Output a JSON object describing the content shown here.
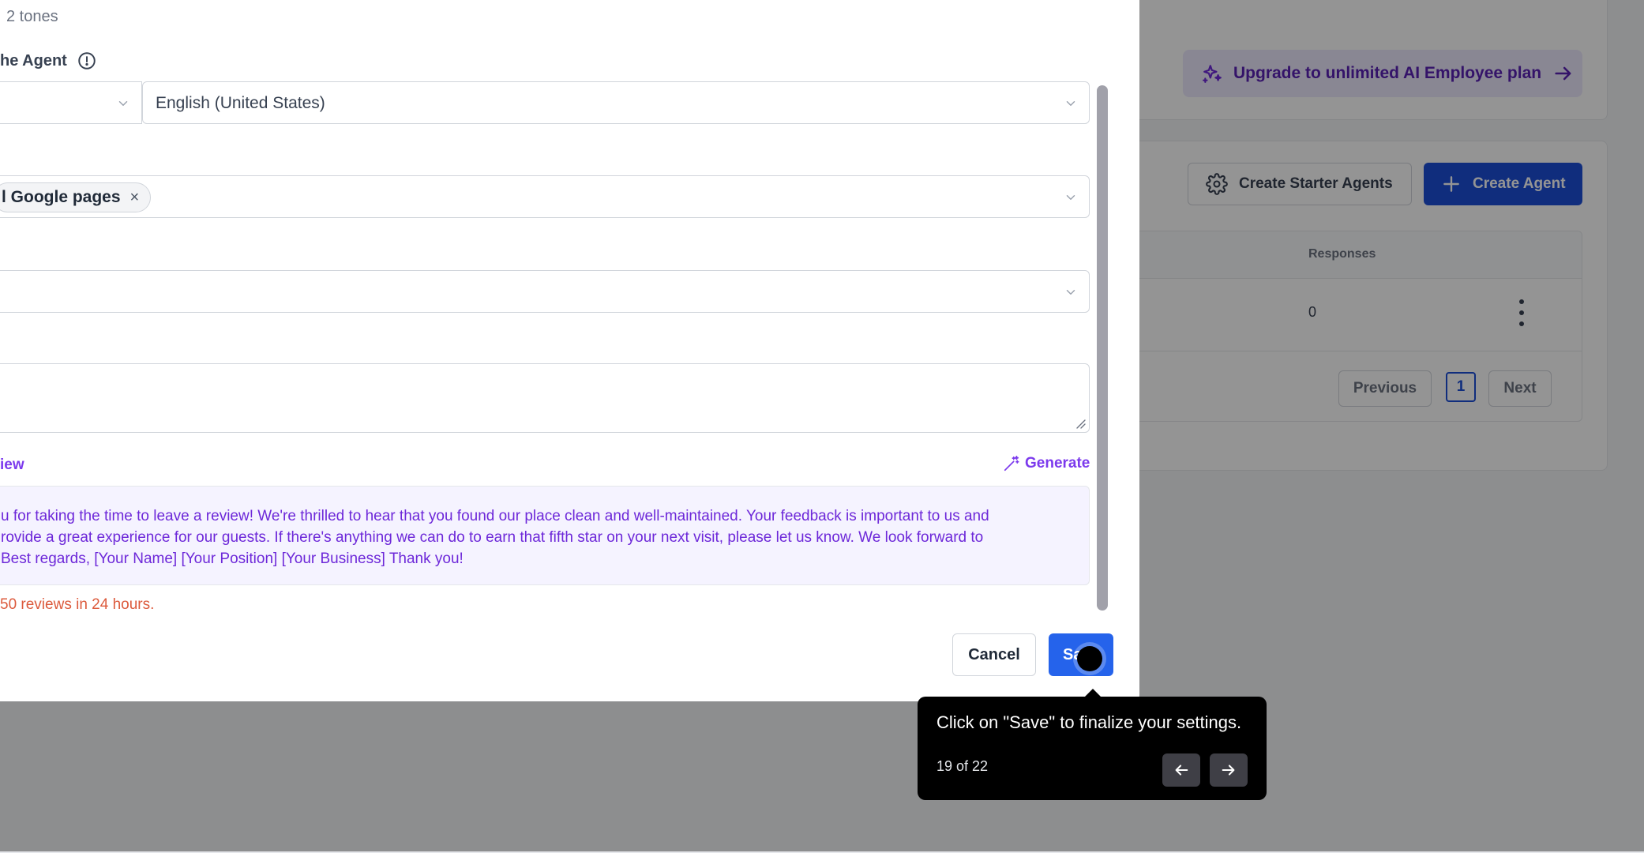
{
  "background": {
    "upgrade_label": "Upgrade to unlimited AI Employee plan",
    "create_starter_label": "Create Starter Agents",
    "create_agent_label": "Create Agent",
    "table": {
      "header_responses": "Responses",
      "rows": [
        {
          "responses": "0"
        }
      ]
    },
    "pagination": {
      "previous": "Previous",
      "current_page": "1",
      "next": "Next"
    }
  },
  "modal": {
    "tones_text": "2 tones",
    "agent_label": "he Agent",
    "language_value": "English (United States)",
    "pages_chip": "l Google pages",
    "chip_remove": "×",
    "preview_label": "iew",
    "generate_label": "Generate",
    "preview_lines": [
      "u for taking the time to leave a review! We're thrilled to hear that you found our place clean and well-maintained. Your feedback is important to us and",
      "rovide a great experience for our guests. If there's anything we can do to earn that fifth star on your next visit, please let us know. We look forward to",
      "Best regards, [Your Name] [Your Position] [Your Business] Thank you!"
    ],
    "limit_note": "50 reviews in 24 hours.",
    "cancel_label": "Cancel",
    "save_label": "Sa"
  },
  "tooltip": {
    "message": "Click on \"Save\" to finalize your settings.",
    "step": "19 of 22"
  },
  "colors": {
    "primary": "#1d4ed8",
    "accent_purple": "#7c3aed",
    "warning": "#dc5a3c"
  }
}
